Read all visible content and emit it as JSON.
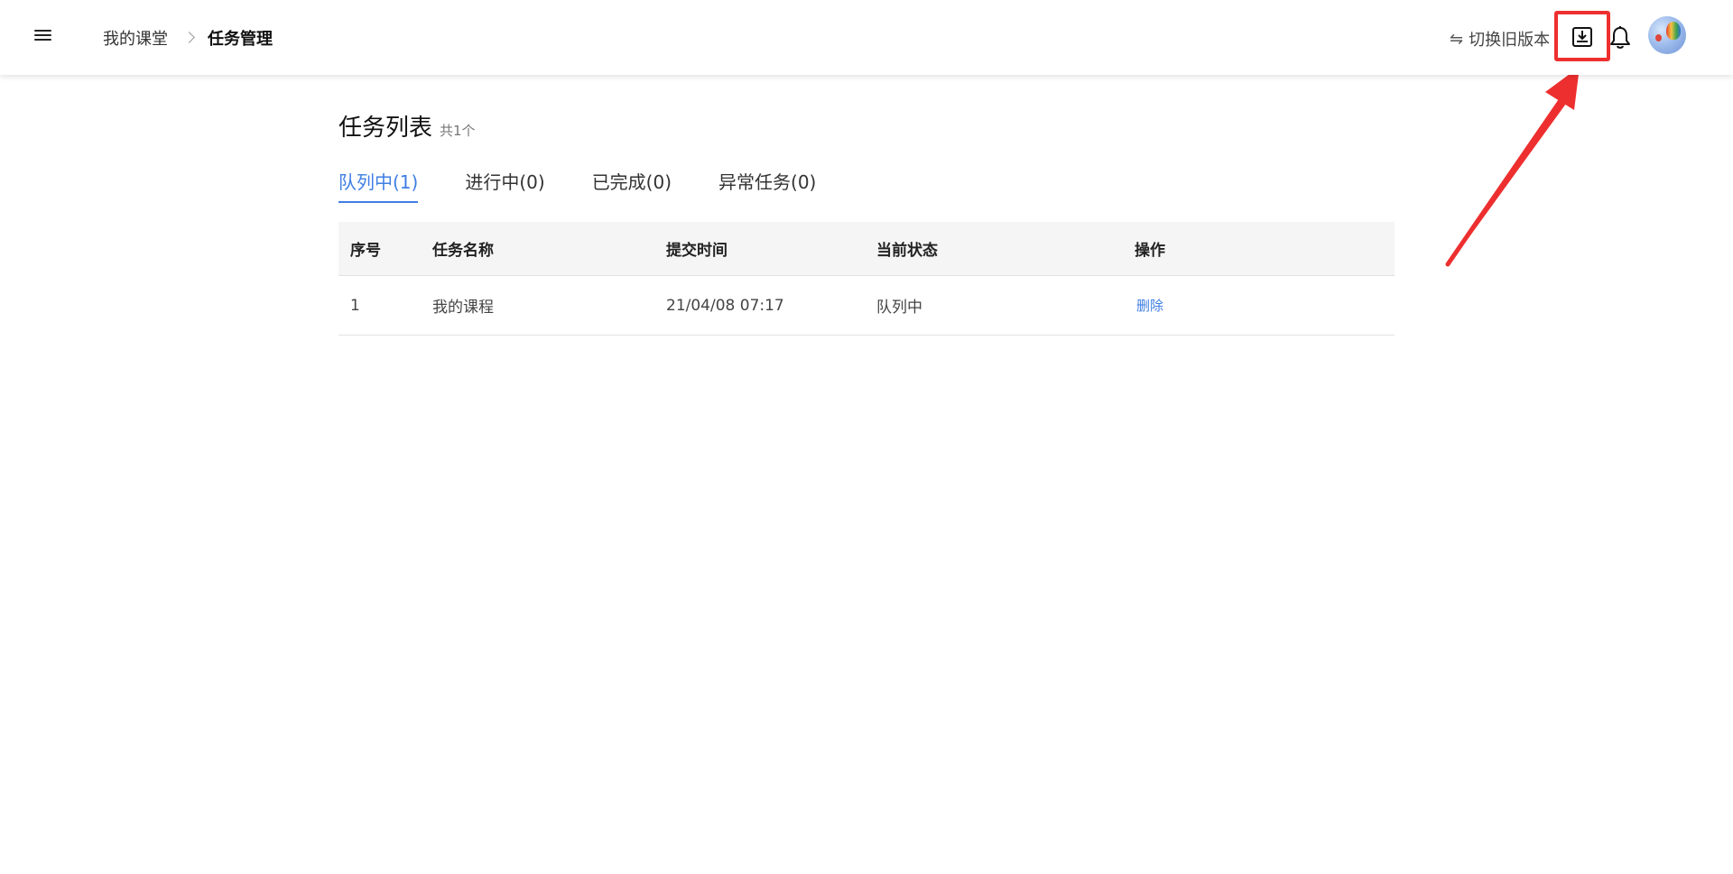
{
  "header": {
    "menu_icon": "hamburger-menu-icon",
    "breadcrumb": {
      "parent": "我的课堂",
      "current": "任务管理"
    },
    "switch_version_label": "切换旧版本",
    "switch_icon": "⇋",
    "download_icon": "download-tray-icon",
    "bell_icon": "bell-icon",
    "highlight_color": "#ee2f2f"
  },
  "main": {
    "title": "任务列表",
    "count": "共1个",
    "tabs": [
      {
        "label": "队列中(1)",
        "active": true
      },
      {
        "label": "进行中(0)",
        "active": false
      },
      {
        "label": "已完成(0)",
        "active": false
      },
      {
        "label": "异常任务(0)",
        "active": false
      }
    ],
    "table": {
      "headers": [
        "序号",
        "任务名称",
        "提交时间",
        "当前状态",
        "操作"
      ],
      "rows": [
        {
          "index": "1",
          "name": "我的课程",
          "time": "21/04/08 07:17",
          "status": "队列中",
          "action": "删除"
        }
      ]
    }
  },
  "colors": {
    "accent": "#3e7ee3",
    "annotation": "#ee2f2f"
  }
}
